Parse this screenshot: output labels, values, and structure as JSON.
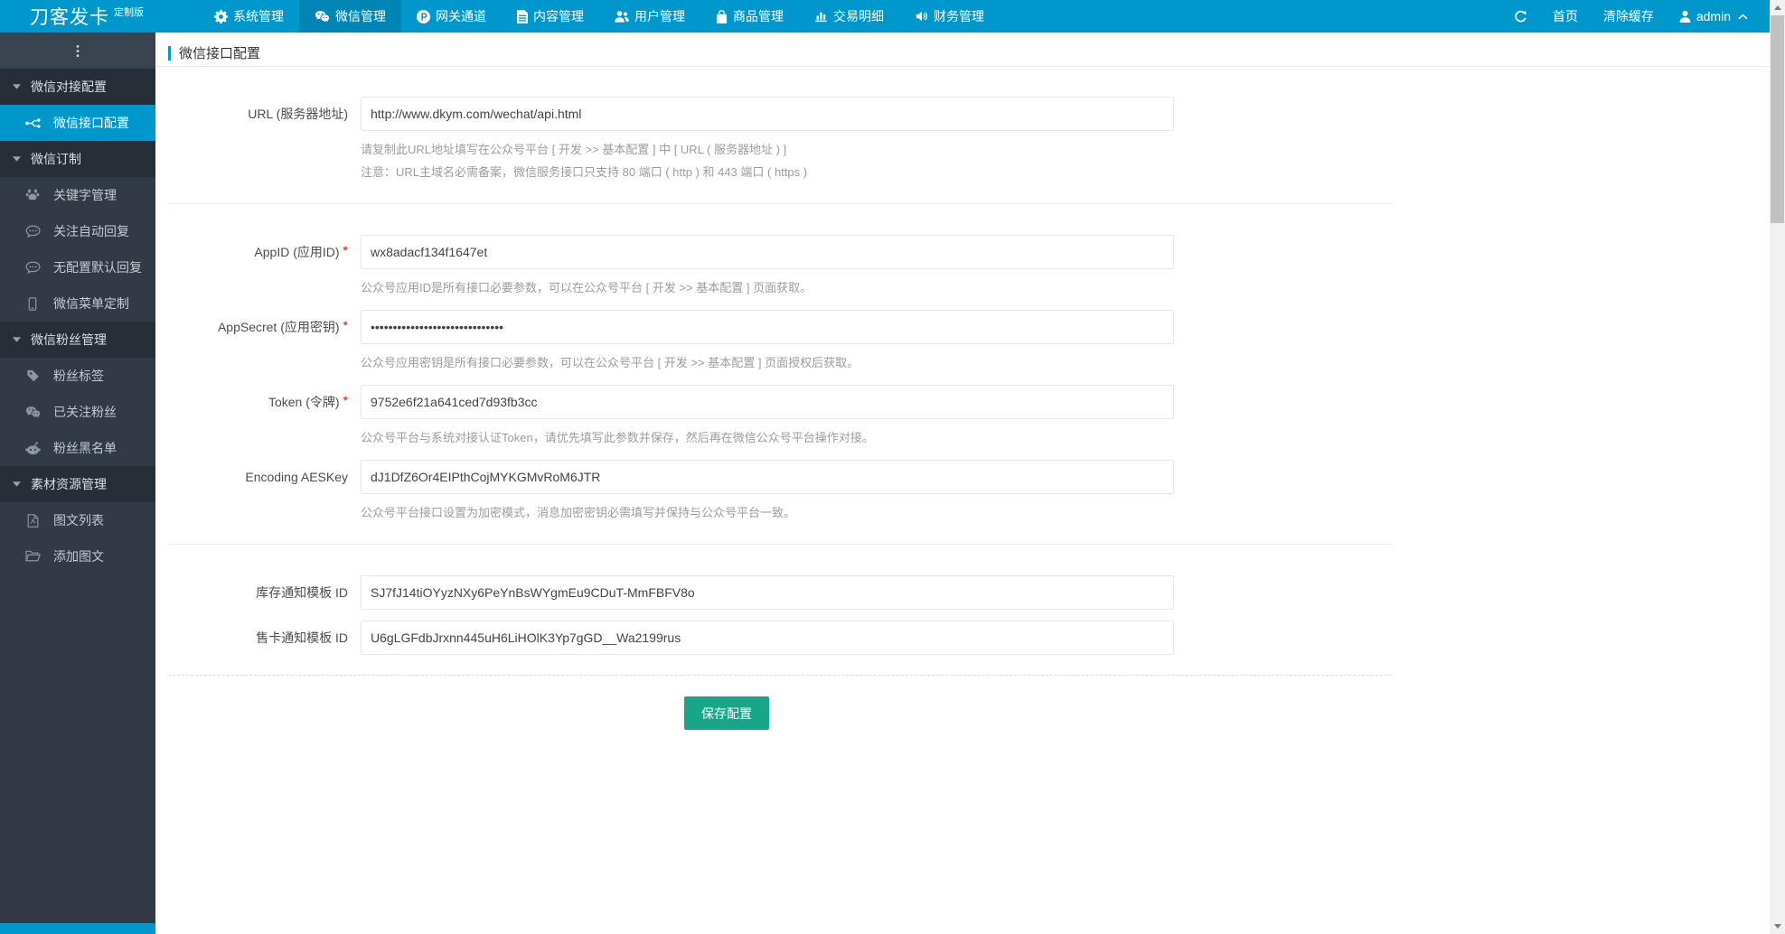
{
  "navbar": {
    "brand": "刀客发卡",
    "brand_badge": "定制版",
    "items": [
      {
        "label": "系统管理",
        "icon": "gear-icon",
        "active": false
      },
      {
        "label": "微信管理",
        "icon": "wechat-icon",
        "active": true
      },
      {
        "label": "网关通道",
        "icon": "gateway-icon",
        "active": false
      },
      {
        "label": "内容管理",
        "icon": "content-icon",
        "active": false
      },
      {
        "label": "用户管理",
        "icon": "users-icon",
        "active": false
      },
      {
        "label": "商品管理",
        "icon": "goods-icon",
        "active": false
      },
      {
        "label": "交易明细",
        "icon": "chart-icon",
        "active": false
      },
      {
        "label": "财务管理",
        "icon": "finance-icon",
        "active": false
      }
    ],
    "right": {
      "home": "首页",
      "clear_cache": "清除缓存",
      "username": "admin"
    }
  },
  "sidebar": {
    "groups": [
      {
        "label": "微信对接配置",
        "items": [
          {
            "label": "微信接口配置",
            "icon": "usb-icon",
            "active": true
          }
        ]
      },
      {
        "label": "微信订制",
        "items": [
          {
            "label": "关键字管理",
            "icon": "paw-icon",
            "active": false
          },
          {
            "label": "关注自动回复",
            "icon": "comment-icon",
            "active": false
          },
          {
            "label": "无配置默认回复",
            "icon": "comment-icon",
            "active": false
          },
          {
            "label": "微信菜单定制",
            "icon": "mobile-icon",
            "active": false
          }
        ]
      },
      {
        "label": "微信粉丝管理",
        "items": [
          {
            "label": "粉丝标签",
            "icon": "tag-icon",
            "active": false
          },
          {
            "label": "已关注粉丝",
            "icon": "wechat-icon",
            "active": false
          },
          {
            "label": "粉丝黑名单",
            "icon": "alien-icon",
            "active": false
          }
        ]
      },
      {
        "label": "素材资源管理",
        "items": [
          {
            "label": "图文列表",
            "icon": "file-pdf-icon",
            "active": false
          },
          {
            "label": "添加图文",
            "icon": "folder-open-icon",
            "active": false
          }
        ]
      }
    ]
  },
  "page": {
    "title": "微信接口配置",
    "fields": [
      {
        "label": "URL (服务器地址)",
        "required": false,
        "value": "http://www.dkym.com/wechat/api.html",
        "helps": [
          "请复制此URL地址填写在公众号平台 [ 开发 >> 基本配置 ] 中 [ URL ( 服务器地址 ) ]",
          "注意：URL主域名必需备案，微信服务接口只支持 80 端口 ( http ) 和 443 端口 ( https )"
        ],
        "divider_after": true
      },
      {
        "label": "AppID (应用ID)",
        "required": true,
        "value": "wx8adacf134f1647et",
        "helps": [
          "公众号应用ID是所有接口必要参数，可以在公众号平台 [ 开发 >> 基本配置 ] 页面获取。"
        ],
        "divider_after": false
      },
      {
        "label": "AppSecret (应用密钥)",
        "required": true,
        "value": "••••••••••••••••••••••••••••••",
        "helps": [
          "公众号应用密钥是所有接口必要参数，可以在公众号平台 [ 开发 >> 基本配置 ] 页面授权后获取。"
        ],
        "divider_after": false
      },
      {
        "label": "Token (令牌)",
        "required": true,
        "value": "9752e6f21a641ced7d93fb3cc",
        "helps": [
          "公众号平台与系统对接认证Token，请优先填写此参数并保存，然后再在微信公众号平台操作对接。"
        ],
        "divider_after": false
      },
      {
        "label": "Encoding AESKey",
        "required": false,
        "value": "dJ1DfZ6Or4EIPthCojMYKGMvRoM6JTR",
        "helps": [
          "公众号平台接口设置为加密模式，消息加密密钥必需填写并保持与公众号平台一致。"
        ],
        "divider_after": true
      },
      {
        "label": "库存通知模板 ID",
        "required": false,
        "value": "SJ7fJ14tiOYyzNXy6PeYnBsWYgmEu9CDuT-MmFBFV8o",
        "helps": [],
        "divider_after": false
      },
      {
        "label": "售卡通知模板 ID",
        "required": false,
        "value": "U6gLGFdbJrxnn445uH6LiHOlK3Yp7gGD__Wa2199rus",
        "helps": [],
        "divider_after": false
      }
    ],
    "save_button": "保存配置"
  },
  "colors": {
    "topbar": "#0097cd",
    "topbar_active": "#0085b5",
    "sidebar": "#323a46",
    "sidebar_group": "#272e38",
    "sidebar_active": "#0097cd",
    "save_button": "#18a689",
    "required_asterisk": "#ff0000",
    "help_text": "#9c9c9c"
  }
}
